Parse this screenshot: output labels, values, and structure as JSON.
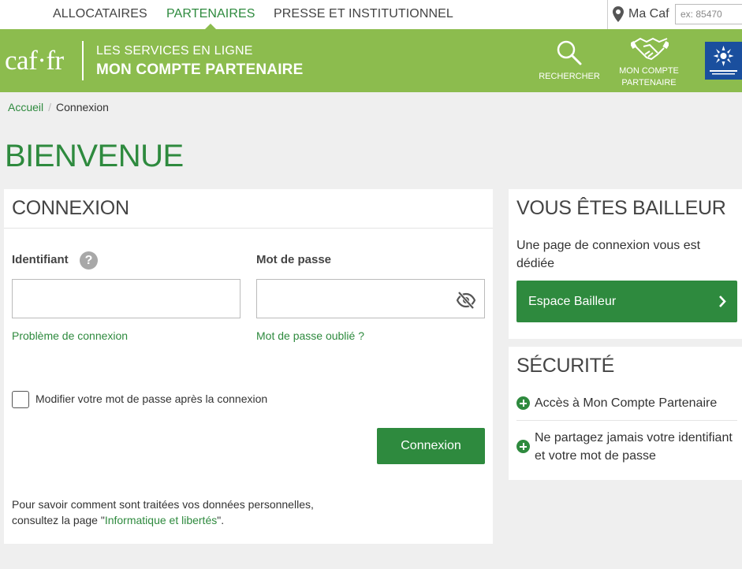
{
  "topnav": {
    "tabs": [
      "ALLOCATAIRES",
      "PARTENAIRES",
      "PRESSE ET INSTITUTIONNEL"
    ],
    "active_tab": "PARTENAIRES",
    "macaf_label": "Ma Caf",
    "postcode_placeholder": "ex: 85470"
  },
  "header": {
    "logo": "caf·fr",
    "subtitle": "LES SERVICES EN LIGNE",
    "title": "MON COMPTE PARTENAIRE",
    "search_label": "RECHERCHER",
    "account_label_line1": "MON COMPTE",
    "account_label_line2": "PARTENAIRE"
  },
  "breadcrumb": {
    "home": "Accueil",
    "current": "Connexion"
  },
  "page_title": "BIENVENUE",
  "login": {
    "title": "CONNEXION",
    "identifiant_label": "Identifiant",
    "identifiant_value": "",
    "password_label": "Mot de passe",
    "password_value": "",
    "problem_link": "Problème de connexion",
    "forgot_link": "Mot de passe oublié ?",
    "checkbox_label": "Modifier votre mot de passe après la connexion",
    "checkbox_checked": false,
    "submit_label": "Connexion",
    "privacy_line1": "Pour savoir comment sont traitées vos données personnelles,",
    "privacy_prefix": "consultez la page \"",
    "privacy_link": "Informatique et libertés",
    "privacy_suffix": "\"."
  },
  "bailleur": {
    "title": "VOUS ÊTES BAILLEUR",
    "description": "Une page de connexion vous est dédiée",
    "button_label": "Espace Bailleur"
  },
  "securite": {
    "title": "SÉCURITÉ",
    "items": [
      "Accès à Mon Compte Partenaire",
      "Ne partagez jamais votre identifiant et votre mot de passe"
    ]
  },
  "colors": {
    "brand_green": "#8cbc4e",
    "action_green": "#2e8a3e",
    "caf_blue": "#1a4f9e"
  }
}
